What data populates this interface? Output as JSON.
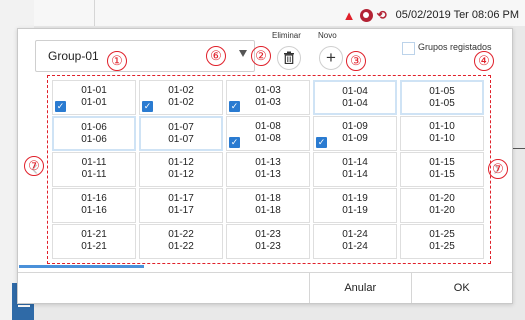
{
  "statusbar": {
    "datetime": "05/02/2019 Ter 08:06 PM",
    "icons": [
      "warning-icon",
      "network-icon",
      "sync-icon"
    ]
  },
  "dialog": {
    "group_select_value": "Group-01",
    "delete_label": "Eliminar",
    "new_label": "Novo",
    "registered_groups_label": "Grupos registados",
    "cancel_label": "Anular",
    "ok_label": "OK"
  },
  "annotations": {
    "a1": "①",
    "a2": "②",
    "a3": "③",
    "a4": "④",
    "a6": "⑥",
    "a7": "⑦"
  },
  "cells": [
    {
      "top": "01-01",
      "bottom": "01-01",
      "checked": true
    },
    {
      "top": "01-02",
      "bottom": "01-02",
      "checked": true
    },
    {
      "top": "01-03",
      "bottom": "01-03",
      "checked": true
    },
    {
      "top": "01-04",
      "bottom": "01-04",
      "checked": false
    },
    {
      "top": "01-05",
      "bottom": "01-05",
      "checked": false
    },
    {
      "top": "01-06",
      "bottom": "01-06",
      "checked": false
    },
    {
      "top": "01-07",
      "bottom": "01-07",
      "checked": false
    },
    {
      "top": "01-08",
      "bottom": "01-08",
      "checked": true
    },
    {
      "top": "01-09",
      "bottom": "01-09",
      "checked": true
    },
    {
      "top": "01-10",
      "bottom": "01-10",
      "checked": false
    },
    {
      "top": "01-11",
      "bottom": "01-11",
      "checked": false
    },
    {
      "top": "01-12",
      "bottom": "01-12",
      "checked": false
    },
    {
      "top": "01-13",
      "bottom": "01-13",
      "checked": false
    },
    {
      "top": "01-14",
      "bottom": "01-14",
      "checked": false
    },
    {
      "top": "01-15",
      "bottom": "01-15",
      "checked": false
    },
    {
      "top": "01-16",
      "bottom": "01-16",
      "checked": false
    },
    {
      "top": "01-17",
      "bottom": "01-17",
      "checked": false
    },
    {
      "top": "01-18",
      "bottom": "01-18",
      "checked": false
    },
    {
      "top": "01-19",
      "bottom": "01-19",
      "checked": false
    },
    {
      "top": "01-20",
      "bottom": "01-20",
      "checked": false
    },
    {
      "top": "01-21",
      "bottom": "01-21",
      "checked": false
    },
    {
      "top": "01-22",
      "bottom": "01-22",
      "checked": false
    },
    {
      "top": "01-23",
      "bottom": "01-23",
      "checked": false
    },
    {
      "top": "01-24",
      "bottom": "01-24",
      "checked": false
    },
    {
      "top": "01-25",
      "bottom": "01-25",
      "checked": false
    }
  ],
  "colors": {
    "annotation_red": "#e0202a",
    "checkbox_blue": "#2a7bd1",
    "progress_blue": "#4a90d9"
  }
}
